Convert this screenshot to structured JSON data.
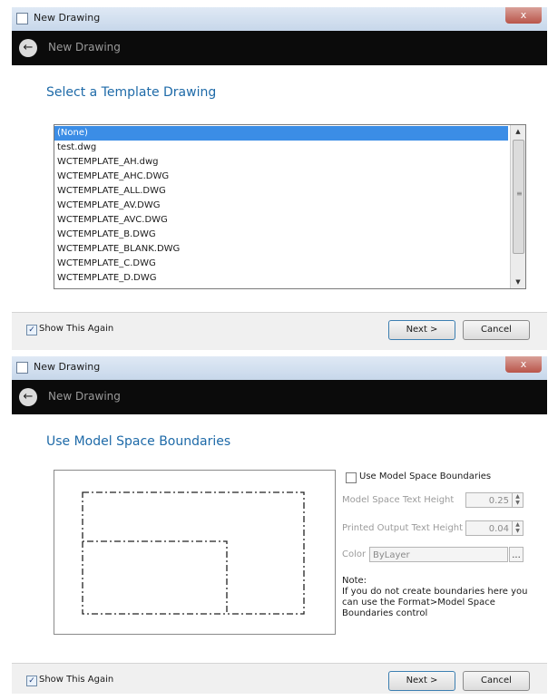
{
  "dialog1": {
    "window_title": "New Drawing",
    "close_glyph": "x",
    "nav_title": "New Drawing",
    "heading": "Select a Template Drawing",
    "templates": [
      "(None)",
      "test.dwg",
      "WCTEMPLATE_AH.dwg",
      "WCTEMPLATE_AHC.DWG",
      "WCTEMPLATE_ALL.DWG",
      "WCTEMPLATE_AV.DWG",
      "WCTEMPLATE_AVC.DWG",
      "WCTEMPLATE_B.DWG",
      "WCTEMPLATE_BLANK.DWG",
      "WCTEMPLATE_C.DWG",
      "WCTEMPLATE_D.DWG"
    ],
    "selected_template": "(None)",
    "show_again_label": "Show This Again",
    "show_again_checked": true,
    "next_label": "Next >",
    "cancel_label": "Cancel"
  },
  "dialog2": {
    "window_title": "New Drawing",
    "close_glyph": "x",
    "nav_title": "New Drawing",
    "heading": "Use Model Space Boundaries",
    "use_boundaries_label": "Use Model Space Boundaries",
    "use_boundaries_checked": false,
    "model_text_height_label": "Model Space Text Height",
    "model_text_height_value": "0.25",
    "printed_text_height_label": "Printed Output Text Height",
    "printed_text_height_value": "0.04",
    "color_label": "Color",
    "color_value": "ByLayer",
    "color_button": "...",
    "note_title": "Note:",
    "note_body": "If you do not create boundaries here you can use the Format>Model Space Boundaries control",
    "show_again_label": "Show This Again",
    "show_again_checked": true,
    "next_label": "Next >",
    "cancel_label": "Cancel"
  },
  "colors": {
    "heading": "#1e6aa8",
    "selection": "#3b8de6",
    "navbar": "#0b0b0b"
  },
  "icons": {
    "back": "back-arrow-icon",
    "app": "app-icon",
    "check": "checkmark-icon"
  }
}
